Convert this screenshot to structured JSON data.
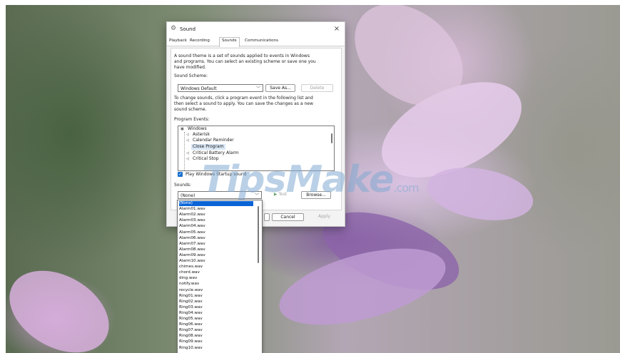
{
  "window": {
    "title": "Sound",
    "icon": "speaker-icon",
    "close": "×"
  },
  "tabs": [
    {
      "label": "Playback"
    },
    {
      "label": "Recording"
    },
    {
      "label": "Sounds",
      "active": true
    },
    {
      "label": "Communications"
    }
  ],
  "sounds_tab": {
    "intro_lines": [
      "A sound theme is a set of sounds applied to events in Windows",
      "and programs.  You can select an existing scheme or save one you",
      "have modified."
    ],
    "scheme_label": "Sound Scheme:",
    "scheme_value": "Windows Default",
    "save_as_label": "Save As...",
    "delete_label": "Delete",
    "change_lines": [
      "To change sounds, click a program event in the following list and",
      "then select a sound to apply.  You can save the changes as a new",
      "sound scheme."
    ],
    "events_label": "Program Events:",
    "events_root": "Windows",
    "events": [
      {
        "label": "Asterisk"
      },
      {
        "label": "Calendar Reminder"
      },
      {
        "label": "Close Program",
        "selected": true
      },
      {
        "label": "Critical Battery Alarm"
      },
      {
        "label": "Critical Stop"
      }
    ],
    "startup_checkbox_label": "Play Windows Startup sound",
    "startup_checked": true,
    "sounds_label": "Sounds:",
    "sounds_value": "(None)",
    "test_label": "Test",
    "browse_label": "Browse...",
    "cancel_label": "Cancel",
    "apply_label": "Apply"
  },
  "sound_dropdown": {
    "selected": "(None)",
    "options": [
      "(None)",
      "Alarm01.wav",
      "Alarm02.wav",
      "Alarm03.wav",
      "Alarm04.wav",
      "Alarm05.wav",
      "Alarm06.wav",
      "Alarm07.wav",
      "Alarm08.wav",
      "Alarm09.wav",
      "Alarm10.wav",
      "chimes.wav",
      "chord.wav",
      "ding.wav",
      "notify.wav",
      "recycle.wav",
      "Ring01.wav",
      "Ring02.wav",
      "Ring03.wav",
      "Ring04.wav",
      "Ring05.wav",
      "Ring06.wav",
      "Ring07.wav",
      "Ring08.wav",
      "Ring09.wav",
      "Ring10.wav"
    ]
  },
  "watermark": {
    "main": "TipsMake",
    "suffix": ".com"
  },
  "colors": {
    "accent": "#0a64d6",
    "selection_bg": "#d9e6f5",
    "dialog_bg": "#f3f3f3"
  }
}
